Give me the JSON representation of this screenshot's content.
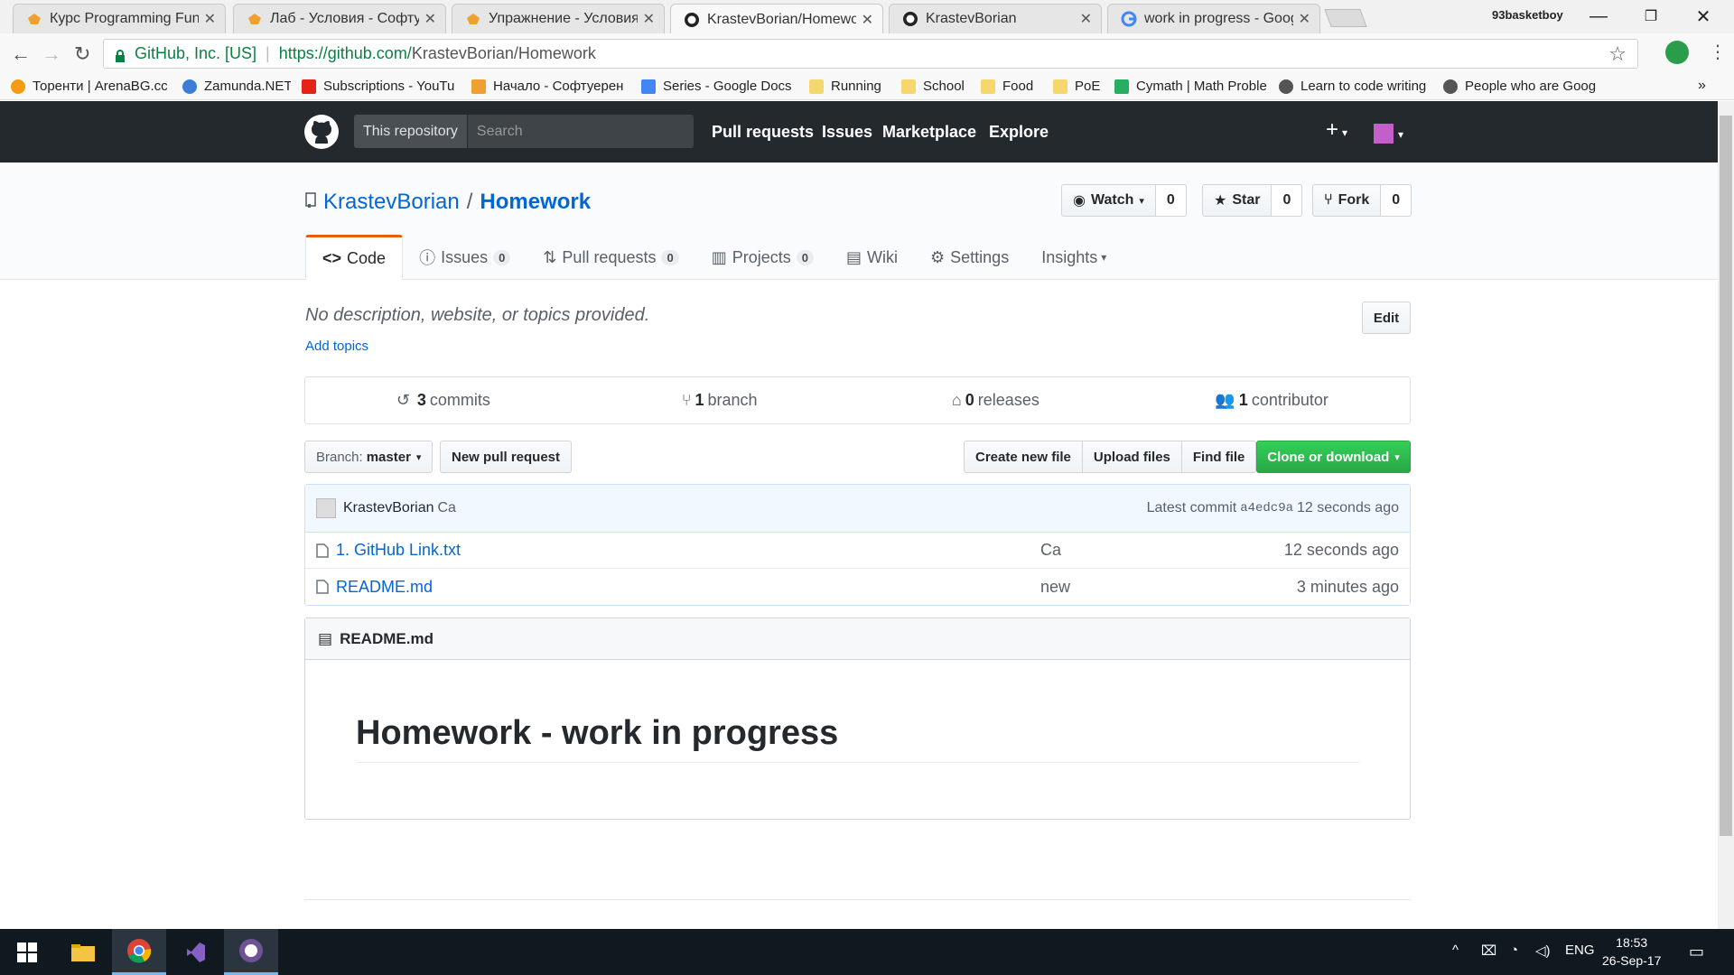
{
  "browser": {
    "tabs": [
      {
        "label": "Курс Programming Fund",
        "active": false,
        "icon": "softuni-icon"
      },
      {
        "label": "Лаб - Условия - Софтус",
        "active": false,
        "icon": "softuni-icon"
      },
      {
        "label": "Упражнение - Условия",
        "active": false,
        "icon": "softuni-icon"
      },
      {
        "label": "KrastevBorian/Homewor",
        "active": true,
        "icon": "github-icon"
      },
      {
        "label": "KrastevBorian",
        "active": false,
        "icon": "github-icon"
      },
      {
        "label": "work in progress - Googl",
        "active": false,
        "icon": "google-icon"
      }
    ],
    "user": "93basketboy",
    "address": {
      "secure_label": "GitHub, Inc. [US]",
      "url_prefix": "https://github.com/",
      "url_rest": "KrastevBorian/Homework"
    },
    "bookmarks": [
      "Торенти | ArenaBG.cc",
      "Zamunda.NET",
      "Subscriptions - YouTu",
      "Начало - Софтуерен",
      "Series - Google Docs",
      "Running",
      "School",
      "Food",
      "PoE",
      "Cymath | Math Proble",
      "Learn to code writing",
      "People who are Goog"
    ],
    "bookmarks_more": "»"
  },
  "github": {
    "search_scope": "This repository",
    "search_placeholder": "Search",
    "nav": [
      "Pull requests",
      "Issues",
      "Marketplace",
      "Explore"
    ],
    "plus": "+",
    "repo_owner": "KrastevBorian",
    "repo_slash": "/",
    "repo_name": "Homework",
    "watch": {
      "label": "Watch",
      "count": "0"
    },
    "star": {
      "label": "Star",
      "count": "0"
    },
    "fork": {
      "label": "Fork",
      "count": "0"
    },
    "tabs": {
      "code": "Code",
      "issues": "Issues",
      "issues_count": "0",
      "pulls": "Pull requests",
      "pulls_count": "0",
      "projects": "Projects",
      "projects_count": "0",
      "wiki": "Wiki",
      "settings": "Settings",
      "insights": "Insights"
    },
    "description": "No description, website, or topics provided.",
    "add_topics": "Add topics",
    "edit": "Edit",
    "summary": {
      "commits_num": "3",
      "commits_label": "commits",
      "branch_num": "1",
      "branch_label": "branch",
      "releases_num": "0",
      "releases_label": "releases",
      "contributor_num": "1",
      "contributor_label": "contributor"
    },
    "branch_prefix": "Branch:",
    "branch_name": "master",
    "new_pr": "New pull request",
    "create_file": "Create new file",
    "upload_files": "Upload files",
    "find_file": "Find file",
    "clone": "Clone or download",
    "commit": {
      "author": "KrastevBorian",
      "message": "Ca",
      "latest_label": "Latest commit",
      "sha": "a4edc9a",
      "age": "12 seconds ago"
    },
    "files": [
      {
        "name": "1. GitHub Link.txt",
        "message": "Ca",
        "age": "12 seconds ago"
      },
      {
        "name": "README.md",
        "message": "new",
        "age": "3 minutes ago"
      }
    ],
    "readme_title": "README.md",
    "readme_h1": "Homework - work in progress"
  },
  "taskbar": {
    "lang": "ENG",
    "time": "18:53",
    "date": "26-Sep-17"
  }
}
